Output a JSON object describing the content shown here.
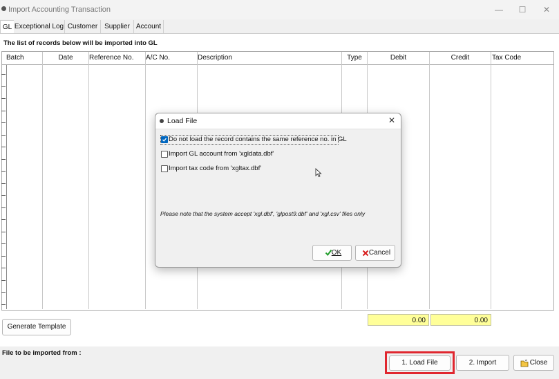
{
  "window": {
    "title": "Import Accounting Transaction",
    "controls": [
      "—",
      "☐",
      "✕"
    ]
  },
  "tabs": [
    "GL",
    "Exceptional Log",
    "Customer",
    "Supplier",
    "Account"
  ],
  "list_label": "The list of records below will be imported into GL",
  "table": {
    "columns": [
      "Batch",
      "Date",
      "Reference No.",
      "A/C No.",
      "Description",
      "Type",
      "Debit",
      "Credit",
      "Tax Code"
    ],
    "rows": []
  },
  "totals": {
    "debit": "0.00",
    "credit": "0.00"
  },
  "buttons": {
    "generate_template": "Generate Template",
    "load_file": "1. Load File",
    "import": "2. Import",
    "close": "Close"
  },
  "file_label": "File to be imported from :",
  "dialog": {
    "title": "Load File",
    "options": [
      {
        "label": "Do not load the record contains the same reference no. in GL",
        "checked": true
      },
      {
        "label": "Import GL account from 'xgldata.dbf'",
        "checked": false
      },
      {
        "label": "Import tax code from 'xgltax.dbf'",
        "checked": false
      }
    ],
    "note": "Please note that the system accept 'xgl.dbf', 'glpost9.dbf' and 'xgl.csv' files only",
    "ok_label": "OK",
    "cancel_label": "Cancel",
    "close_glyph": "✕"
  },
  "colors": {
    "highlight": "#e0272f",
    "total_bg": "#ffff99",
    "checkbox": "#0067c0"
  }
}
